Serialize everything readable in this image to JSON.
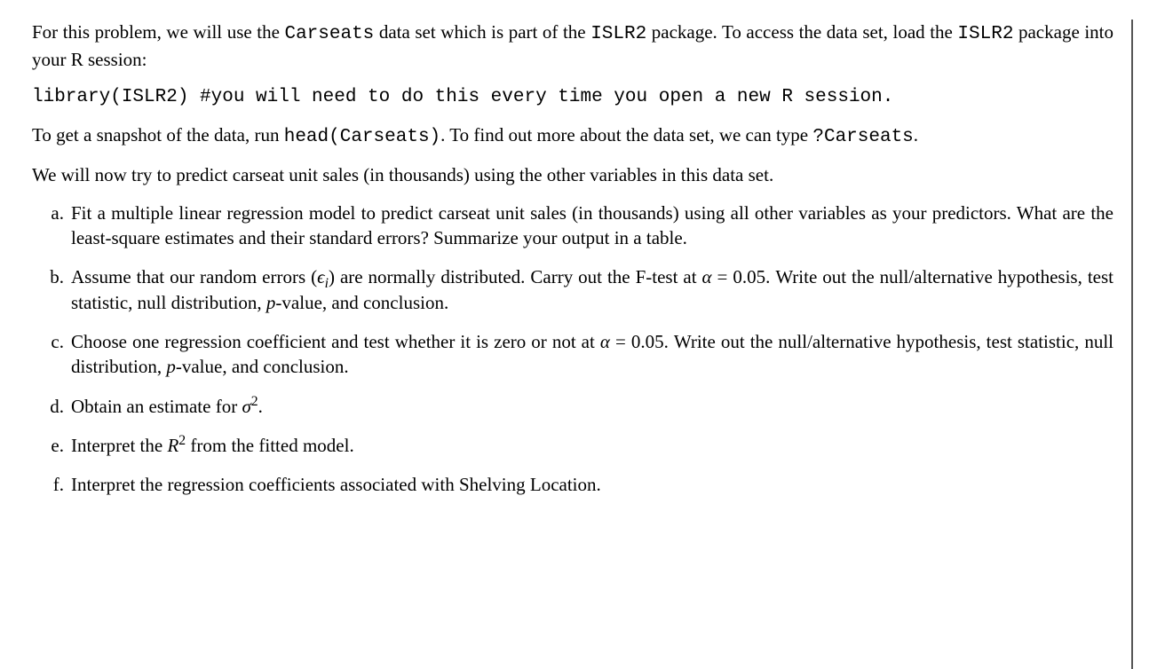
{
  "paragraphs": {
    "intro1_a": "For this problem, we will use the ",
    "intro1_b": " data set which is part of the ",
    "intro1_c": " package. To access the data set, load the ",
    "intro1_d": " package into your R session:",
    "code_carseats": "Carseats",
    "code_islr2": "ISLR2",
    "code_line": "library(ISLR2) #you will need to do this every time you open a new R session.",
    "intro2_a": "To get a snapshot of the data, run ",
    "intro2_b": ". To find out more about the data set, we can type ",
    "intro2_c": ".",
    "code_head": "head(Carseats)",
    "code_qcarseats": "?Carseats",
    "intro3": "We will now try to predict carseat unit sales (in thousands) using the other variables in this data set."
  },
  "items": {
    "a": "Fit a multiple linear regression model to predict carseat unit sales (in thousands) using all other variables as your predictors. What are the least-square estimates and their standard errors? Summarize your output in a table.",
    "b_a": "Assume that our random errors (",
    "b_b": ") are normally distributed. Carry out the F-test at ",
    "b_c": " = 0.05. Write out the null/alternative hypothesis, test statistic, null distribution, ",
    "b_d": "-value, and conclusion.",
    "c_a": "Choose one regression coefficient and test whether it is zero or not at ",
    "c_b": " = 0.05. Write out the null/alternative hypothesis, test statistic, null distribution, ",
    "c_c": "-value, and conclusion.",
    "d_a": "Obtain an estimate for ",
    "d_b": ".",
    "e_a": "Interpret the ",
    "e_b": " from the fitted model.",
    "f": "Interpret the regression coefficients associated with Shelving Location."
  },
  "labels": {
    "a": "a",
    "b": "b",
    "c": "c",
    "d": "d",
    "e": "e",
    "f": "f"
  },
  "math": {
    "epsilon": "ϵ",
    "i": "i",
    "alpha": "α",
    "p": "p",
    "sigma": "σ",
    "two": "2",
    "R": "R"
  }
}
